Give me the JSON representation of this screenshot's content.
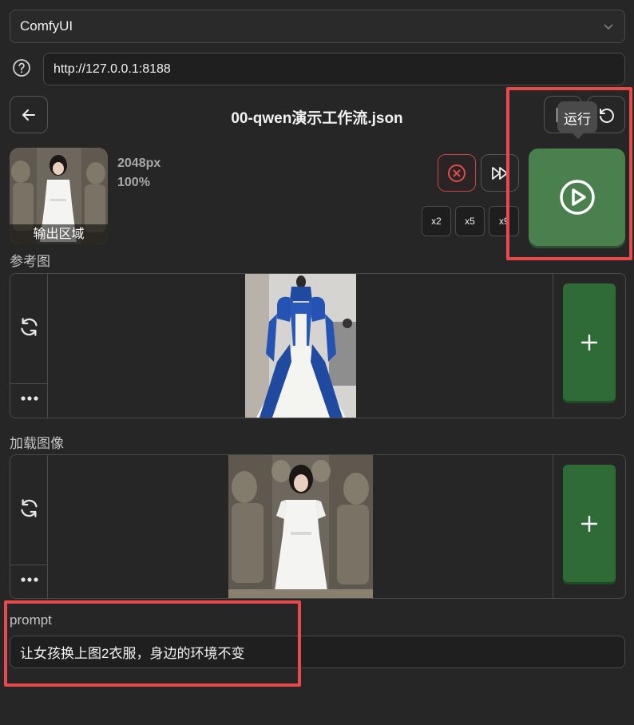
{
  "server_select": {
    "value": "ComfyUI"
  },
  "server_url": {
    "value": "http://127.0.0.1:8188"
  },
  "header": {
    "title": "00-qwen演示工作流.json",
    "tooltip": "运行"
  },
  "output": {
    "label": "输出区域",
    "size": "2048px",
    "zoom": "100%"
  },
  "batch": {
    "x2": "x2",
    "x5": "x5",
    "x9": "x9"
  },
  "sections": {
    "reference": {
      "label": "参考图"
    },
    "load": {
      "label": "加载图像"
    },
    "prompt": {
      "label": "prompt",
      "value": "让女孩换上图2衣服，身边的环境不变"
    }
  },
  "colors": {
    "accent_red": "#e8494b",
    "run_green": "#4a7f4e",
    "add_green": "#2e6b37"
  }
}
